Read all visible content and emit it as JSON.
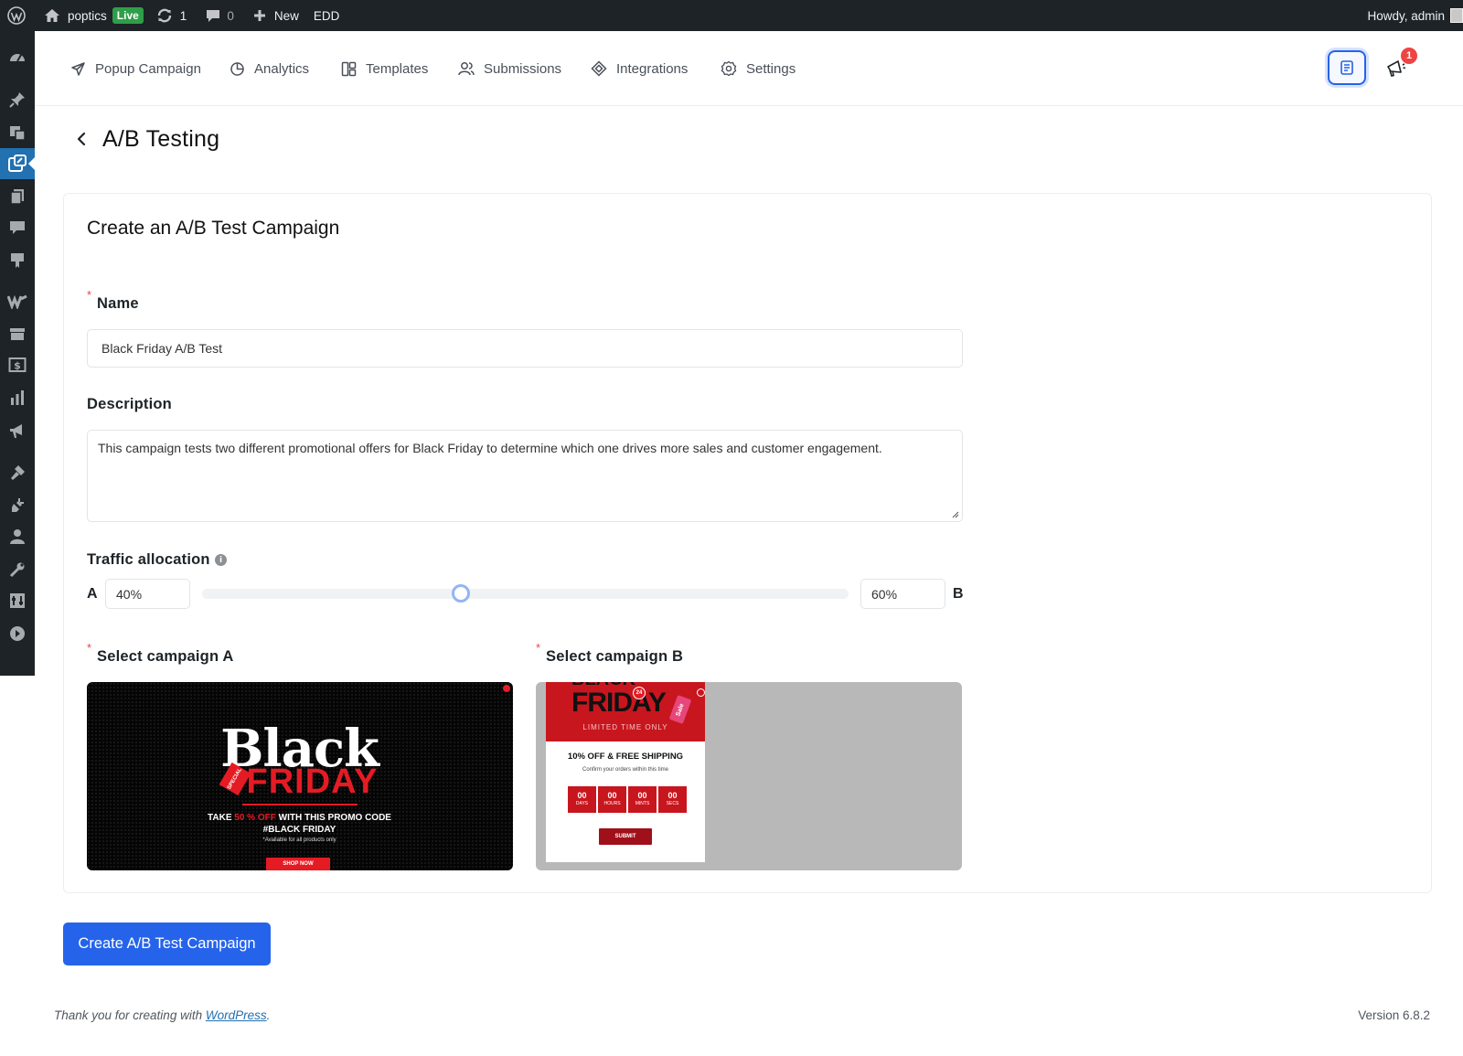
{
  "admin_bar": {
    "site_name": "poptics",
    "live_badge": "Live",
    "updates_count": "1",
    "comments_count": "0",
    "new_label": "New",
    "edd_label": "EDD",
    "greeting": "Howdy, admin"
  },
  "admin_menu": {
    "icons": [
      "dashboard-icon",
      "posts-pin-icon",
      "media-icon",
      "poptics-icon",
      "pages-icon",
      "comments-icon",
      "feedback-icon",
      "woocommerce-icon",
      "products-icon",
      "payments-icon",
      "analytics-icon",
      "marketing-icon",
      "appearance-icon",
      "plugins-icon",
      "users-icon",
      "tools-icon",
      "settings-icon",
      "collapse-icon"
    ],
    "active_index": 3
  },
  "plugin_nav": {
    "items": [
      {
        "label": "Popup Campaign",
        "icon": "send-icon"
      },
      {
        "label": "Analytics",
        "icon": "pie-chart-icon"
      },
      {
        "label": "Templates",
        "icon": "layout-icon"
      },
      {
        "label": "Submissions",
        "icon": "users-icon"
      },
      {
        "label": "Integrations",
        "icon": "diamond-icon"
      },
      {
        "label": "Settings",
        "icon": "gear-icon"
      }
    ],
    "notification_count": "1"
  },
  "page": {
    "title": "A/B Testing"
  },
  "form": {
    "heading": "Create an A/B Test Campaign",
    "required_mark": "*",
    "name_label": "Name",
    "name_value": "Black Friday A/B Test",
    "description_label": "Description",
    "description_value": "This campaign tests two different promotional offers for Black Friday to determine which one drives more sales and customer engagement.",
    "traffic_label": "Traffic allocation",
    "info_glyph": "i",
    "letter_a": "A",
    "letter_b": "B",
    "traffic_a": "40%",
    "traffic_b": "60%",
    "traffic_split_percent": 40,
    "campaign_a_label": "Select campaign A",
    "campaign_b_label": "Select campaign B",
    "submit_label": "Create A/B Test Campaign"
  },
  "preview_a": {
    "title_word": "Black",
    "subtitle_word": "FRIDAY",
    "ribbon": "SPECIAL",
    "take_prefix": "TAKE ",
    "take_highlight": "50 % OFF",
    "take_suffix": " WITH THIS PROMO CODE",
    "promo_code": "#BLACK FRIDAY",
    "note": "*Available for all products only",
    "shop_button": "SHOP NOW"
  },
  "preview_b": {
    "title_top": "BLACK",
    "title_word": "FRIDAY",
    "badge": "24",
    "sale_tag": "Sale",
    "limited": "LIMITED TIME ONLY",
    "offer": "10% OFF & FREE SHIPPING",
    "confirm": "Confirm your orders within this time",
    "countdown": [
      {
        "value": "00",
        "unit": "DAYS"
      },
      {
        "value": "00",
        "unit": "HOURS"
      },
      {
        "value": "00",
        "unit": "MINTS"
      },
      {
        "value": "00",
        "unit": "SECS"
      }
    ],
    "submit": "SUBMIT"
  },
  "footer": {
    "thanks_prefix": "Thank you for creating with ",
    "wordpress_link": "WordPress",
    "thanks_suffix": ".",
    "version": "Version 6.8.2"
  }
}
